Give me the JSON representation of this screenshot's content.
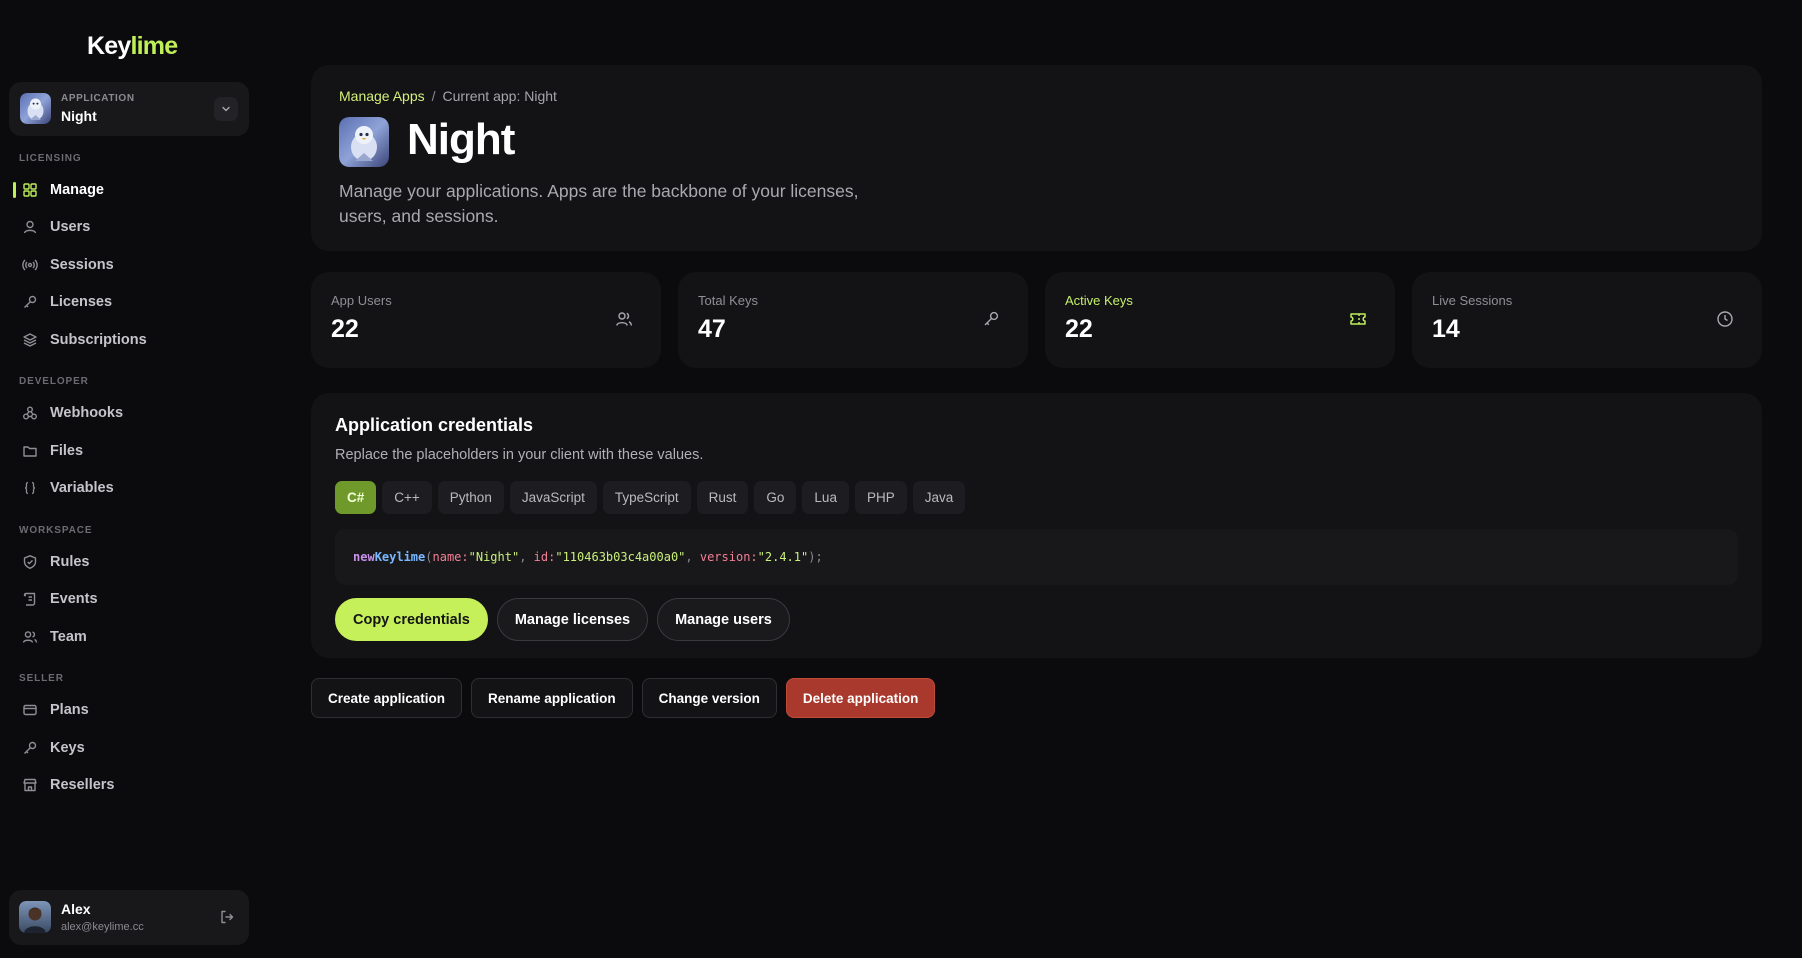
{
  "brand": {
    "name_main": "Key",
    "name_accent": "lime",
    "accent_color": "#bff05a"
  },
  "app_switcher": {
    "label": "APPLICATION",
    "name": "Night"
  },
  "sidebar": {
    "sections": [
      {
        "title": "LICENSING",
        "items": [
          {
            "label": "Manage",
            "icon": "grid-icon",
            "active": true
          },
          {
            "label": "Users",
            "icon": "user-icon"
          },
          {
            "label": "Sessions",
            "icon": "broadcast-icon"
          },
          {
            "label": "Licenses",
            "icon": "key-icon"
          },
          {
            "label": "Subscriptions",
            "icon": "layers-icon"
          }
        ]
      },
      {
        "title": "DEVELOPER",
        "items": [
          {
            "label": "Webhooks",
            "icon": "webhook-icon"
          },
          {
            "label": "Files",
            "icon": "folder-icon"
          },
          {
            "label": "Variables",
            "icon": "braces-icon"
          }
        ]
      },
      {
        "title": "WORKSPACE",
        "items": [
          {
            "label": "Rules",
            "icon": "shield-icon"
          },
          {
            "label": "Events",
            "icon": "scroll-icon"
          },
          {
            "label": "Team",
            "icon": "team-icon"
          }
        ]
      },
      {
        "title": "SELLER",
        "items": [
          {
            "label": "Plans",
            "icon": "card-icon"
          },
          {
            "label": "Keys",
            "icon": "key-icon"
          },
          {
            "label": "Resellers",
            "icon": "store-icon"
          }
        ]
      }
    ]
  },
  "user": {
    "name": "Alex",
    "email": "alex@keylime.cc"
  },
  "header": {
    "breadcrumb_link": "Manage Apps",
    "breadcrumb_sep": "/",
    "breadcrumb_current": "Current app: Night",
    "title": "Night",
    "description": "Manage your applications. Apps are the backbone of your licenses, users, and sessions."
  },
  "stats": [
    {
      "label": "App Users",
      "value": "22",
      "icon": "users-icon"
    },
    {
      "label": "Total Keys",
      "value": "47",
      "icon": "key-icon"
    },
    {
      "label": "Active Keys",
      "value": "22",
      "icon": "ticket-icon",
      "accent": true
    },
    {
      "label": "Live Sessions",
      "value": "14",
      "icon": "clock-icon"
    }
  ],
  "credentials": {
    "title": "Application credentials",
    "subtitle": "Replace the placeholders in your client with these values.",
    "languages": [
      "C#",
      "C++",
      "Python",
      "JavaScript",
      "TypeScript",
      "Rust",
      "Go",
      "Lua",
      "PHP",
      "Java"
    ],
    "active_language": "C#",
    "code": {
      "kw": "new",
      "cls": "Keylime",
      "p_name": "name:",
      "v_name": "\"Night\"",
      "p_id": "id:",
      "v_id": "\"110463b03c4a00a0\"",
      "p_ver": "version:",
      "v_ver": "\"2.4.1\""
    },
    "buttons": {
      "copy": "Copy credentials",
      "licenses": "Manage licenses",
      "users": "Manage users"
    }
  },
  "actions": {
    "create": "Create application",
    "rename": "Rename application",
    "version": "Change version",
    "delete": "Delete application",
    "danger_color": "#a8392c"
  }
}
